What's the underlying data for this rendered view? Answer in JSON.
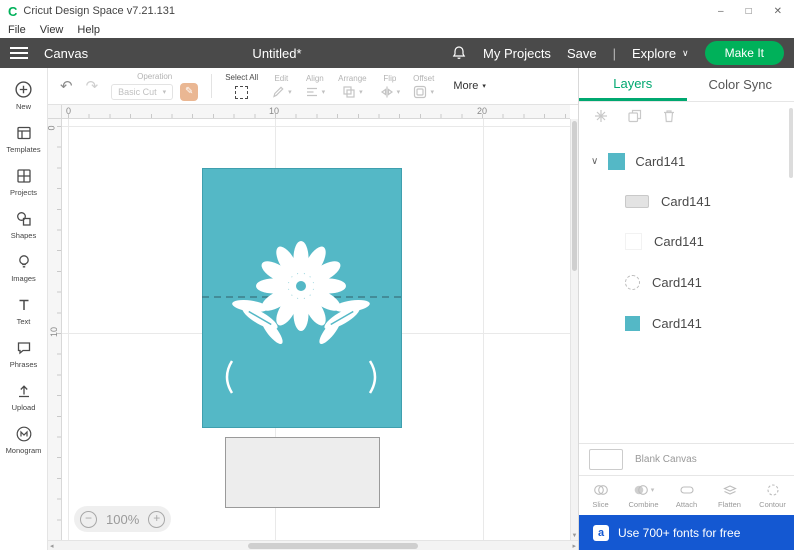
{
  "titlebar": {
    "title": "Cricut Design Space  v7.21.131",
    "min": "–",
    "max": "□",
    "close": "✕"
  },
  "menubar": {
    "items": [
      "File",
      "View",
      "Help"
    ]
  },
  "header": {
    "canvas": "Canvas",
    "doc_title": "Untitled*",
    "my_projects": "My Projects",
    "save": "Save",
    "pipe": "|",
    "explore": "Explore",
    "make_it": "Make It"
  },
  "sidebar": {
    "items": [
      "New",
      "Templates",
      "Projects",
      "Shapes",
      "Images",
      "Text",
      "Phrases",
      "Upload",
      "Monogram"
    ]
  },
  "toolbar": {
    "operation_label": "Operation",
    "operation_value": "Basic Cut",
    "select_all": "Select All",
    "edit": "Edit",
    "align": "Align",
    "arrange": "Arrange",
    "flip": "Flip",
    "offset": "Offset",
    "more": "More"
  },
  "canvas": {
    "h_ticks": [
      "0",
      "10",
      "20"
    ],
    "v_ticks": [
      "0",
      "10"
    ],
    "zoom": "100%"
  },
  "layers": {
    "tab_layers": "Layers",
    "tab_color_sync": "Color Sync",
    "group": {
      "label": "Card141"
    },
    "items": [
      {
        "label": "Card141",
        "thumb": "gray-rect"
      },
      {
        "label": "Card141",
        "thumb": "white"
      },
      {
        "label": "Card141",
        "thumb": "dashed-circle"
      },
      {
        "label": "Card141",
        "thumb": "teal-square"
      }
    ],
    "blank_canvas": "Blank Canvas",
    "actions": [
      {
        "label": "Slice"
      },
      {
        "label": "Combine"
      },
      {
        "label": "Attach"
      },
      {
        "label": "Flatten"
      },
      {
        "label": "Contour"
      }
    ]
  },
  "banner": {
    "badge": "a",
    "text": "Use 700+ fonts for free"
  },
  "colors": {
    "accent_green": "#00b15a",
    "tab_green": "#00a870",
    "card_teal": "#54b8c6",
    "banner_blue": "#1458d2"
  }
}
